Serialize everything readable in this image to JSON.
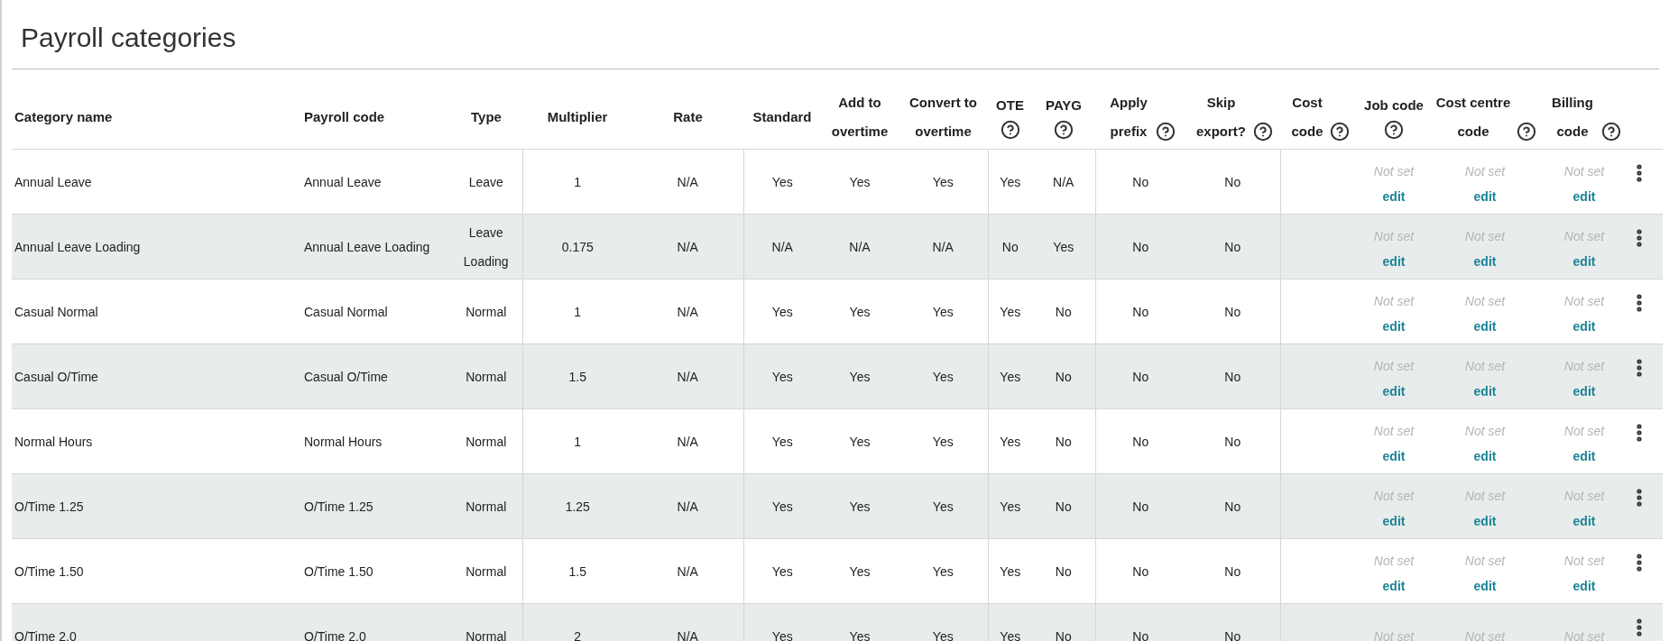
{
  "page": {
    "title": "Payroll categories"
  },
  "table": {
    "columns": [
      {
        "label": "Category name",
        "help": false
      },
      {
        "label": "Payroll code",
        "help": false
      },
      {
        "label": "Type",
        "help": false
      },
      {
        "label": "Multiplier",
        "help": false
      },
      {
        "label": "Rate",
        "help": false
      },
      {
        "label": "Standard",
        "help": false
      },
      {
        "label": "Add to overtime",
        "help": false
      },
      {
        "label": "Convert to overtime",
        "help": false
      },
      {
        "label": "OTE",
        "help": true
      },
      {
        "label": "PAYG",
        "help": true
      },
      {
        "label": "Apply prefix",
        "help": true
      },
      {
        "label": "Skip export?",
        "help": true
      },
      {
        "label": "Cost code",
        "help": true
      },
      {
        "label": "Job code",
        "help": true
      },
      {
        "label": "Cost centre code",
        "help": true
      },
      {
        "label": "Billing code",
        "help": true
      }
    ],
    "rows": [
      {
        "cells": [
          "Annual Leave",
          "Annual Leave",
          "Leave",
          "1",
          "N/A",
          "Yes",
          "Yes",
          "Yes",
          "Yes",
          "N/A",
          "No",
          "No"
        ],
        "codes": [
          {
            "value": "Not set",
            "link": "edit"
          },
          {
            "value": "Not set",
            "link": "edit"
          },
          {
            "value": "Not set",
            "link": "edit"
          }
        ]
      },
      {
        "cells": [
          "Annual Leave Loading",
          "Annual Leave Loading",
          "Leave Loading",
          "0.175",
          "N/A",
          "N/A",
          "N/A",
          "N/A",
          "No",
          "Yes",
          "No",
          "No"
        ],
        "codes": [
          {
            "value": "Not set",
            "link": "edit"
          },
          {
            "value": "Not set",
            "link": "edit"
          },
          {
            "value": "Not set",
            "link": "edit"
          }
        ]
      },
      {
        "cells": [
          "Casual Normal",
          "Casual Normal",
          "Normal",
          "1",
          "N/A",
          "Yes",
          "Yes",
          "Yes",
          "Yes",
          "No",
          "No",
          "No"
        ],
        "codes": [
          {
            "value": "Not set",
            "link": "edit"
          },
          {
            "value": "Not set",
            "link": "edit"
          },
          {
            "value": "Not set",
            "link": "edit"
          }
        ]
      },
      {
        "cells": [
          "Casual O/Time",
          "Casual O/Time",
          "Normal",
          "1.5",
          "N/A",
          "Yes",
          "Yes",
          "Yes",
          "Yes",
          "No",
          "No",
          "No"
        ],
        "codes": [
          {
            "value": "Not set",
            "link": "edit"
          },
          {
            "value": "Not set",
            "link": "edit"
          },
          {
            "value": "Not set",
            "link": "edit"
          }
        ]
      },
      {
        "cells": [
          "Normal Hours",
          "Normal Hours",
          "Normal",
          "1",
          "N/A",
          "Yes",
          "Yes",
          "Yes",
          "Yes",
          "No",
          "No",
          "No"
        ],
        "codes": [
          {
            "value": "Not set",
            "link": "edit"
          },
          {
            "value": "Not set",
            "link": "edit"
          },
          {
            "value": "Not set",
            "link": "edit"
          }
        ]
      },
      {
        "cells": [
          "O/Time 1.25",
          "O/Time 1.25",
          "Normal",
          "1.25",
          "N/A",
          "Yes",
          "Yes",
          "Yes",
          "Yes",
          "No",
          "No",
          "No"
        ],
        "codes": [
          {
            "value": "Not set",
            "link": "edit"
          },
          {
            "value": "Not set",
            "link": "edit"
          },
          {
            "value": "Not set",
            "link": "edit"
          }
        ]
      },
      {
        "cells": [
          "O/Time 1.50",
          "O/Time 1.50",
          "Normal",
          "1.5",
          "N/A",
          "Yes",
          "Yes",
          "Yes",
          "Yes",
          "No",
          "No",
          "No"
        ],
        "codes": [
          {
            "value": "Not set",
            "link": "edit"
          },
          {
            "value": "Not set",
            "link": "edit"
          },
          {
            "value": "Not set",
            "link": "edit"
          }
        ]
      },
      {
        "cells": [
          "O/Time 2.0",
          "O/Time 2.0",
          "Normal",
          "2",
          "N/A",
          "Yes",
          "Yes",
          "Yes",
          "Yes",
          "No",
          "No",
          "No"
        ],
        "codes": [
          {
            "value": "Not set"
          },
          {
            "value": "Not set"
          },
          {
            "value": "Not set"
          }
        ]
      }
    ]
  }
}
